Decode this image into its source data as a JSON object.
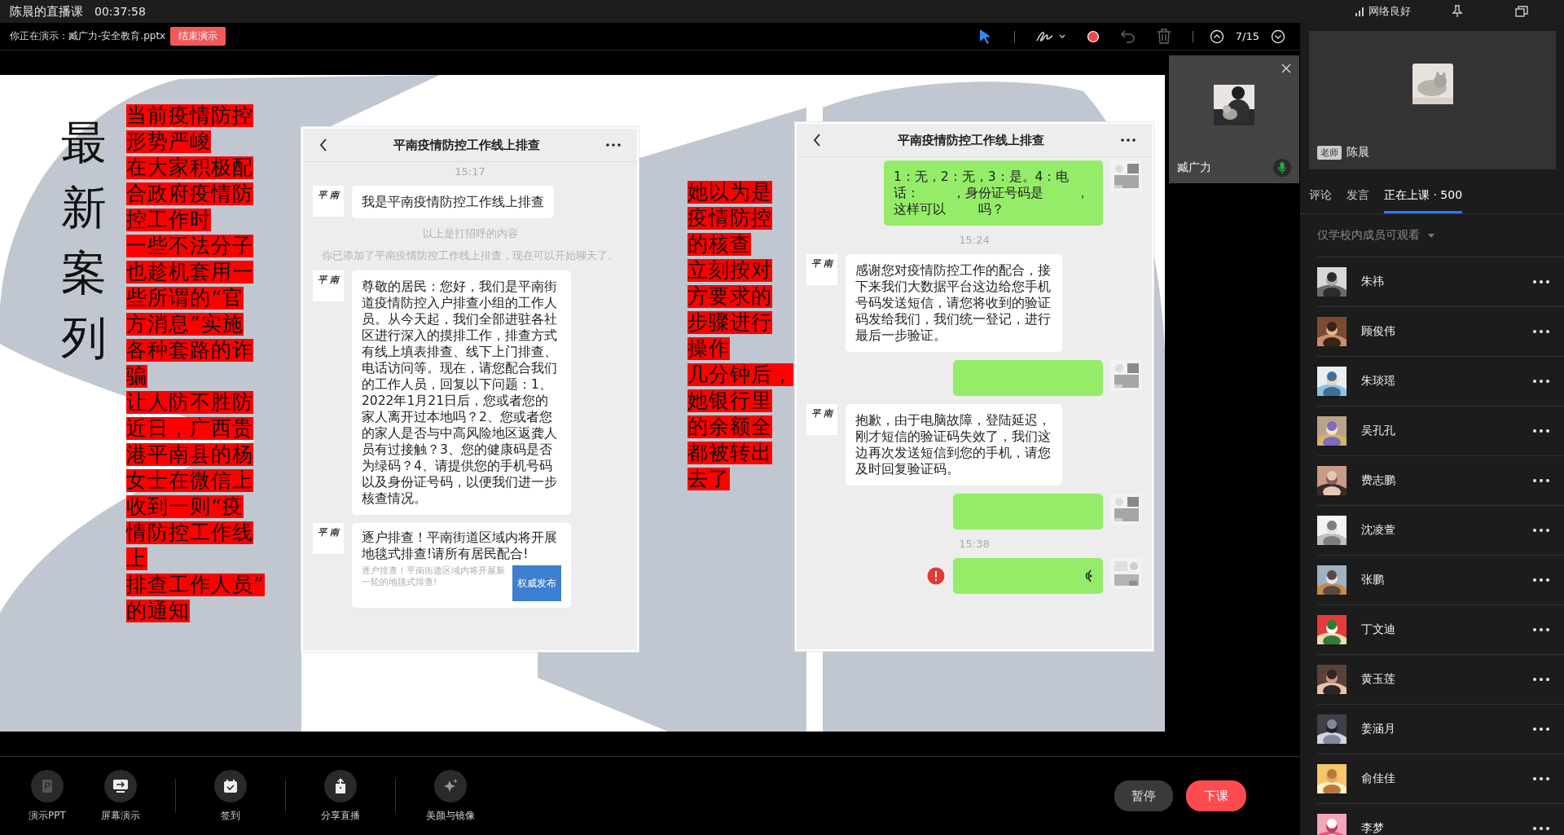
{
  "window": {
    "title": "陈晨的直播课",
    "timer": "00:37:58",
    "network_status": "网络良好"
  },
  "presenting_bar": {
    "label": "你正在演示：臧广力-安全教育.pptx",
    "stop_button": "结束演示",
    "page_indicator": "7/15",
    "tools": [
      {
        "kind": "pointer",
        "selected": true,
        "disabled": false
      },
      {
        "kind": "pen",
        "selected": false,
        "disabled": false
      },
      {
        "kind": "color",
        "selected": false,
        "disabled": false
      },
      {
        "kind": "undo",
        "selected": false,
        "disabled": true
      },
      {
        "kind": "delete",
        "selected": false,
        "disabled": true
      }
    ]
  },
  "slide": {
    "title": "最新案列",
    "left_lines": [
      "当前疫情防控",
      "形势严峻",
      "在大家积极配",
      "合政府疫情防",
      "控工作时",
      "一些不法分子",
      "也趁机套用一",
      "些所谓的“官",
      "方消息”实施",
      "各种套路的诈",
      "骗",
      "让人防不胜防",
      "近日，广西贵",
      "港平南县的杨",
      "女士在微信上",
      "收到一则“疫",
      "情防控工作线",
      "上",
      "排查工作人员”",
      "的通知"
    ],
    "middle_lines": [
      "她以为是",
      "疫情防控",
      "的核查",
      "立刻按对",
      "方要求的",
      "步骤进行",
      "操作",
      "几分钟后，",
      "她银行里",
      "的余额全",
      "都被转出",
      "去了"
    ],
    "chats": [
      {
        "title": "平南疫情防控工作线上排查",
        "messages": [
          {
            "kind": "time",
            "text": "15:17"
          },
          {
            "kind": "incoming",
            "avatar": "平 南",
            "text": "我是平南疫情防控工作线上排查"
          },
          {
            "kind": "system",
            "text": "以上是打招呼的内容"
          },
          {
            "kind": "system",
            "text": "你已添加了平南疫情防控工作线上排查，现在可以开始聊天了。"
          },
          {
            "kind": "incoming",
            "avatar": "平 南",
            "text": "尊敬的居民：您好，我们是平南街道疫情防控入户排查小组的工作人员。从今天起，我们全部进驻各社区进行深入的摸排工作，排查方式有线上填表排查、线下上门排查、电话访问等。现在，请您配合我们的工作人员，回复以下问题：1、2022年1月21日后，您或者您的家人离开过本地吗？2、您或者您的家人是否与中高风险地区返龚人员有过接触？3、您的健康码是否为绿码？4、请提供您的手机号码以及身份证号码，以便我们进一步核查情况。"
          },
          {
            "kind": "card",
            "avatar": "平 南",
            "title": "逐户排查！平南街道区域内将开展地毯式排查!请所有居民配合!",
            "description": "逐户排查！平南街道区域内将开展新一轮的地毯式排查!",
            "thumbnail": "权威发布"
          }
        ]
      },
      {
        "title": "平南疫情防控工作线上排查",
        "messages": [
          {
            "kind": "outgoing",
            "parts": [
              "1：无，2：无，3：是。4：电话：",
              "，身份证号码是",
              "，这样可以",
              "吗？"
            ]
          },
          {
            "kind": "time",
            "text": "15:24"
          },
          {
            "kind": "incoming",
            "avatar": "平 南",
            "text": "感谢您对疫情防控工作的配合，接下来我们大数据平台这边给您手机号码发送短信，请您将收到的验证码发给我们，我们统一登记，进行最后一步验证。"
          },
          {
            "kind": "outgoing"
          },
          {
            "kind": "incoming",
            "avatar": "平 南",
            "text": "抱歉，由于电脑故障，登陆延迟，刚才短信的验证码失效了，我们这边再次发送短信到您的手机，请您及时回复验证码。"
          },
          {
            "kind": "outgoing"
          },
          {
            "kind": "time",
            "text": "15:38"
          },
          {
            "kind": "voice",
            "failed": true
          }
        ]
      }
    ]
  },
  "video_tile": {
    "name": "臧广力",
    "mic_on": true
  },
  "teacher": {
    "badge": "老师",
    "name": "陈晨"
  },
  "tabs": [
    {
      "label": "评论",
      "selected": false
    },
    {
      "label": "发言",
      "selected": false
    },
    {
      "label": "正在上课 · 500",
      "selected": true
    }
  ],
  "visibility_filter": "仅学校内成员可观看",
  "members": [
    {
      "name": "朱祎"
    },
    {
      "name": "顾俊伟"
    },
    {
      "name": "朱琰瑶"
    },
    {
      "name": "吴孔孔"
    },
    {
      "name": "费志鹏"
    },
    {
      "name": "沈凌萱"
    },
    {
      "name": "张鹏"
    },
    {
      "name": "丁文迪"
    },
    {
      "name": "黄玉莲"
    },
    {
      "name": "姜涵月"
    },
    {
      "name": "俞佳佳"
    },
    {
      "name": "李梦"
    }
  ],
  "bottom_tools": [
    {
      "kind": "ppt",
      "label": "演示PPT",
      "disabled": true
    },
    {
      "kind": "screen",
      "label": "屏幕演示",
      "disabled": false
    },
    {
      "kind": "checkin",
      "label": "签到",
      "disabled": false
    },
    {
      "kind": "share",
      "label": "分享直播",
      "disabled": false
    },
    {
      "kind": "beauty",
      "label": "美颜与镜像",
      "disabled": false
    }
  ],
  "buttons": {
    "pause": "暂停",
    "end_class": "下课"
  }
}
